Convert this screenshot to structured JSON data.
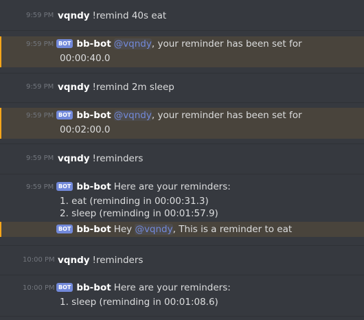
{
  "messages": [
    {
      "timestamp": "9:59 PM",
      "author": "vqndy",
      "bot": false,
      "text": "!remind 40s eat"
    },
    {
      "timestamp": "9:59 PM",
      "author": "bb-bot",
      "bot": true,
      "badge": "BOT",
      "mention": "@vqndy",
      "text": ", your reminder has been set for",
      "line2": "00:00:40.0"
    },
    {
      "timestamp": "9:59 PM",
      "author": "vqndy",
      "bot": false,
      "text": "!remind 2m sleep"
    },
    {
      "timestamp": "9:59 PM",
      "author": "bb-bot",
      "bot": true,
      "badge": "BOT",
      "mention": "@vqndy",
      "text": ", your reminder has been set for",
      "line2": "00:02:00.0"
    },
    {
      "timestamp": "9:59 PM",
      "author": "vqndy",
      "bot": false,
      "text": "!reminders"
    },
    {
      "timestamp": "9:59 PM",
      "author": "bb-bot",
      "bot": true,
      "badge": "BOT",
      "text": "Here are your reminders:",
      "line2": "1. eat (reminding in 00:00:31.3)",
      "line3": "2. sleep (reminding in 00:01:57.9)"
    },
    {
      "author": "bb-bot",
      "bot": true,
      "badge": "BOT",
      "text_pre": "Hey ",
      "mention": "@vqndy",
      "text": ", This is a reminder to eat"
    },
    {
      "timestamp": "10:00 PM",
      "author": "vqndy",
      "bot": false,
      "text": "!reminders"
    },
    {
      "timestamp": "10:00 PM",
      "author": "bb-bot",
      "bot": true,
      "badge": "BOT",
      "text": "Here are your reminders:",
      "line2": "1. sleep (reminding in 00:01:08.6)"
    }
  ],
  "colors": {
    "background": "#36393f",
    "highlight": "#49443c",
    "highlight_border": "#faa61a",
    "mention": "#7289da",
    "badge": "#7289da",
    "timestamp": "#72767d",
    "text": "#dcddde"
  }
}
